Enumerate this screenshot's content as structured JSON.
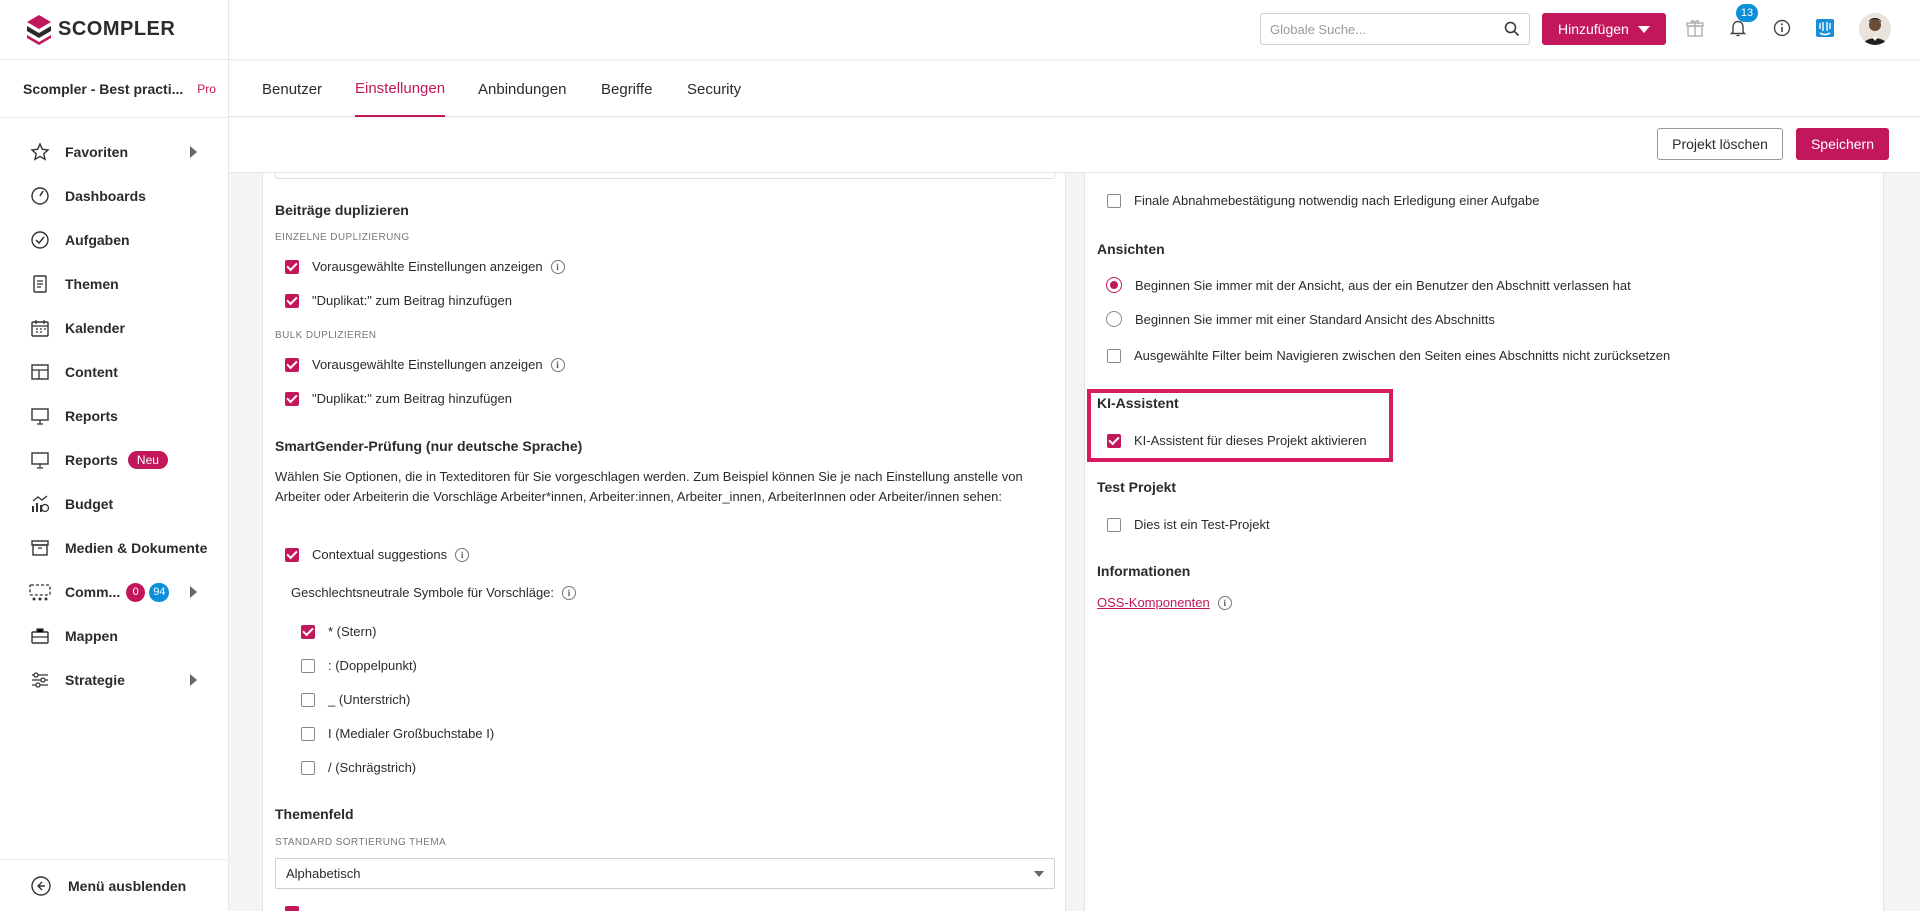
{
  "brand": {
    "name": "SCOMPLER"
  },
  "project": {
    "name": "Scompler - Best practi...",
    "tier": "Pro"
  },
  "sidebar": {
    "items": [
      {
        "label": "Favoriten"
      },
      {
        "label": "Dashboards"
      },
      {
        "label": "Aufgaben"
      },
      {
        "label": "Themen"
      },
      {
        "label": "Kalender"
      },
      {
        "label": "Content"
      },
      {
        "label": "Reports"
      },
      {
        "label": "Reports",
        "badge": "Neu"
      },
      {
        "label": "Budget"
      },
      {
        "label": "Medien & Dokumente"
      },
      {
        "label": "Comm...",
        "badge_red": "0",
        "badge_blue": "94"
      },
      {
        "label": "Mappen"
      },
      {
        "label": "Strategie"
      }
    ],
    "hide_menu_label": "Menü ausblenden"
  },
  "header": {
    "search_placeholder": "Globale Suche...",
    "add_label": "Hinzufügen",
    "notification_count": "13"
  },
  "tabs": [
    {
      "label": "Benutzer"
    },
    {
      "label": "Einstellungen"
    },
    {
      "label": "Anbindungen"
    },
    {
      "label": "Begriffe"
    },
    {
      "label": "Security"
    }
  ],
  "actions": {
    "delete_label": "Projekt löschen",
    "save_label": "Speichern"
  },
  "left": {
    "dup_title": "Beiträge duplizieren",
    "single_sub": "EINZELNE DUPLIZIERUNG",
    "single_opt1": "Vorausgewählte Einstellungen anzeigen",
    "single_opt2": "\"Duplikat:\" zum Beitrag hinzufügen",
    "bulk_sub": "BULK DUPLIZIEREN",
    "bulk_opt1": "Vorausgewählte Einstellungen anzeigen",
    "bulk_opt2": "\"Duplikat:\" zum Beitrag hinzufügen",
    "gender_title": "SmartGender-Prüfung (nur deutsche Sprache)",
    "gender_desc": "Wählen Sie Optionen, die in Texteditoren für Sie vorgeschlagen werden. Zum Beispiel können Sie je nach Einstellung anstelle von Arbeiter oder Arbeiterin die Vorschläge Arbeiter*innen, Arbeiter:innen, Arbeiter_innen, ArbeiterInnen oder Arbeiter/innen sehen:",
    "contextual_label": "Contextual suggestions",
    "symbols_label": "Geschlechtsneutrale Symbole für Vorschläge:",
    "symbols": [
      {
        "label": "* (Stern)",
        "checked": true
      },
      {
        "label": ": (Doppelpunkt)",
        "checked": false
      },
      {
        "label": "_ (Unterstrich)",
        "checked": false
      },
      {
        "label": "I (Medialer Großbuchstabe I)",
        "checked": false
      },
      {
        "label": "/ (Schrägstrich)",
        "checked": false
      }
    ],
    "themen_title": "Themenfeld",
    "sort_sub": "STANDARD SORTIERUNG THEMA",
    "sort_value": "Alphabetisch"
  },
  "right": {
    "final_label": "Finale Abnahmebestätigung notwendig nach Erledigung einer Aufgabe",
    "views_title": "Ansichten",
    "view_opt1": "Beginnen Sie immer mit der Ansicht, aus der ein Benutzer den Abschnitt verlassen hat",
    "view_opt2": "Beginnen Sie immer mit einer Standard Ansicht des Abschnitts",
    "filter_label": "Ausgewählte Filter beim Navigieren zwischen den Seiten eines Abschnitts nicht zurücksetzen",
    "ki_title": "KI-Assistent",
    "ki_label": "KI-Assistent für dieses Projekt aktivieren",
    "test_title": "Test Projekt",
    "test_label": "Dies ist ein Test-Projekt",
    "info_title": "Informationen",
    "oss_link": "OSS-Komponenten"
  },
  "colors": {
    "accent": "#c2185b",
    "badge_blue": "#0a8fd8",
    "highlight": "#d81b60"
  }
}
